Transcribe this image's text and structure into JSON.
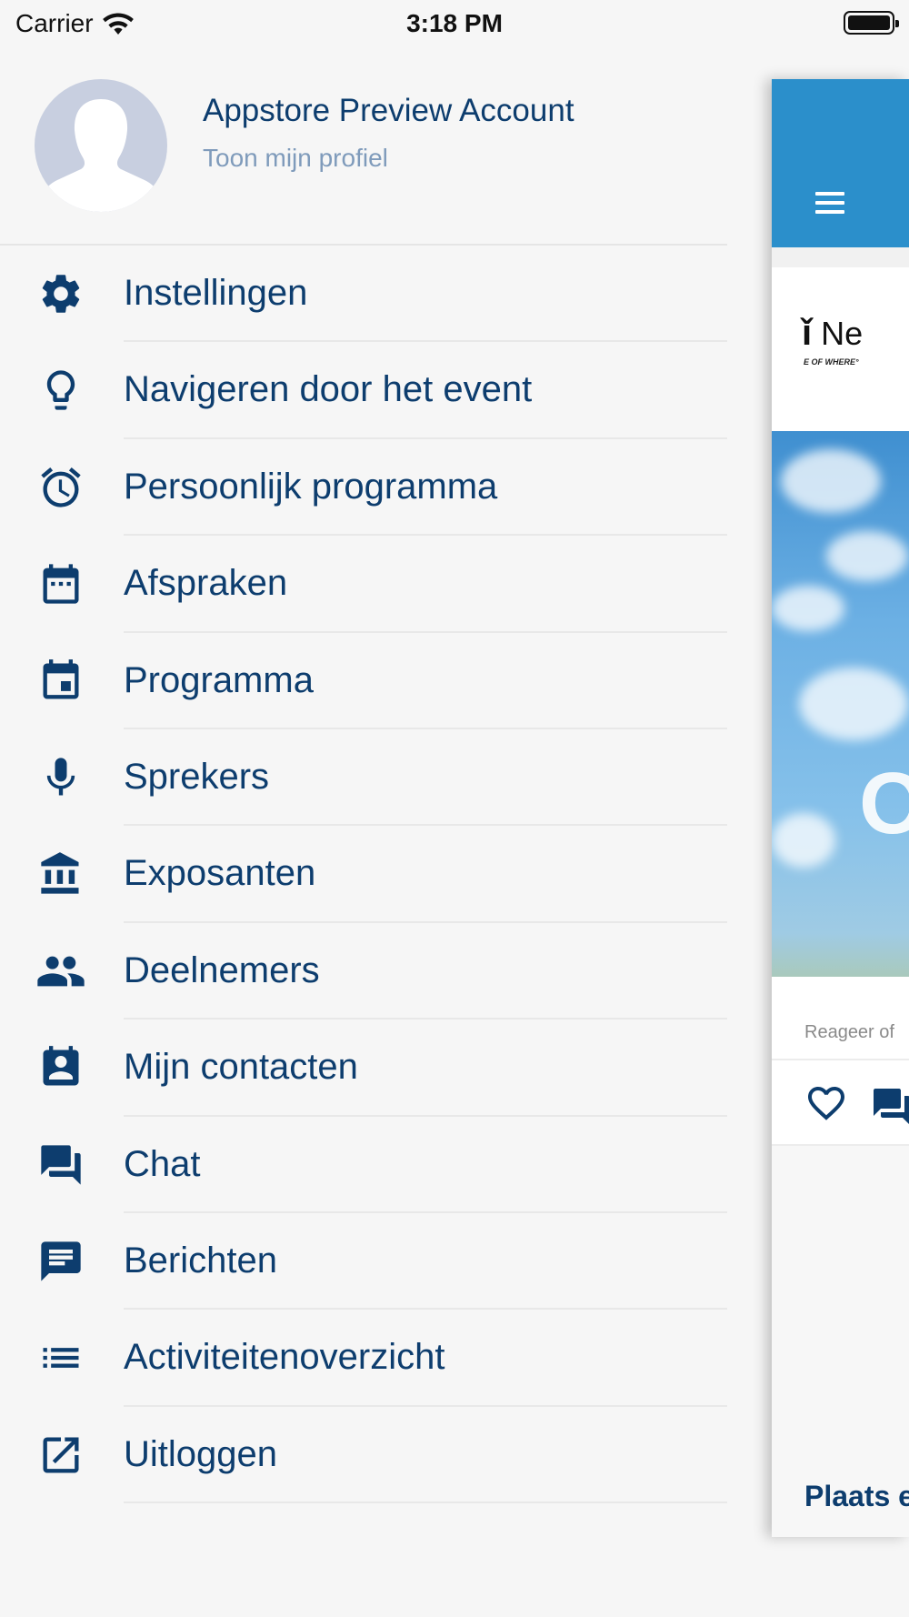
{
  "status_bar": {
    "carrier": "Carrier",
    "time": "3:18 PM"
  },
  "profile": {
    "name": "Appstore Preview Account",
    "link": "Toon mijn profiel"
  },
  "menu": {
    "items": [
      {
        "label": "Instellingen",
        "icon": "gear-icon"
      },
      {
        "label": "Navigeren door het event",
        "icon": "lightbulb-icon"
      },
      {
        "label": "Persoonlijk programma",
        "icon": "alarm-clock-icon"
      },
      {
        "label": "Afspraken",
        "icon": "calendar-dots-icon"
      },
      {
        "label": "Programma",
        "icon": "calendar-event-icon"
      },
      {
        "label": "Sprekers",
        "icon": "microphone-icon"
      },
      {
        "label": "Exposanten",
        "icon": "bank-icon"
      },
      {
        "label": "Deelnemers",
        "icon": "people-icon"
      },
      {
        "label": "Mijn contacten",
        "icon": "contact-card-icon"
      },
      {
        "label": "Chat",
        "icon": "forum-icon"
      },
      {
        "label": "Berichten",
        "icon": "message-icon"
      },
      {
        "label": "Activiteitenoverzicht",
        "icon": "list-icon"
      },
      {
        "label": "Uitloggen",
        "icon": "open-external-icon"
      }
    ]
  },
  "main": {
    "logo_text": "Ne",
    "logo_tag": "E OF WHERE°",
    "banner_letter": "O",
    "react_text": "Reageer of",
    "post_text": "Plaats e"
  },
  "colors": {
    "text_primary": "#0d3d6e",
    "text_secondary": "#7f9bbb",
    "header_blue": "#2b8fcb",
    "background": "#f6f6f6"
  }
}
